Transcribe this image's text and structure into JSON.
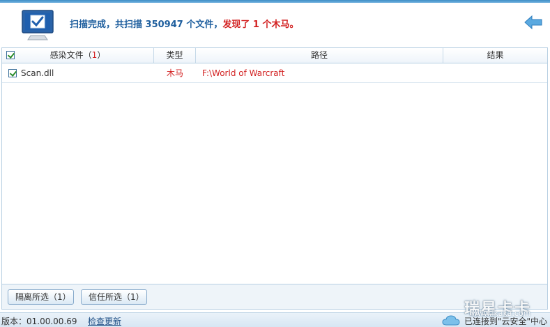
{
  "header": {
    "status_prefix": "扫描完成，共扫描",
    "scanned_count": "350947",
    "status_mid": "个文件，",
    "found_prefix": "发现了",
    "found_count": "1",
    "found_suffix": "个木马。"
  },
  "table": {
    "columns": {
      "file": "感染文件（",
      "file_count": "1",
      "file_close": "）",
      "type": "类型",
      "path": "路径",
      "result": "结果"
    },
    "rows": [
      {
        "name": "Scan.dll",
        "type": "木马",
        "path": "F:\\World of Warcraft",
        "result": ""
      }
    ]
  },
  "buttons": {
    "quarantine": "隔离所选（1）",
    "trust": "信任所选（1）"
  },
  "statusbar": {
    "version": "版本：01.00.00.69",
    "update": "检查更新",
    "cloud": "已连接到\"云安全\"中心"
  },
  "watermark": {
    "text": "瑞星卡卡",
    "url": "www.ikaka.com"
  },
  "colors": {
    "accent_blue": "#1f5f9e",
    "alert_red": "#d21f1f",
    "border": "#b7cfe2"
  },
  "icons": {
    "monitor": "monitor-check-icon",
    "back": "back-arrow-icon",
    "cloud": "cloud-icon"
  }
}
